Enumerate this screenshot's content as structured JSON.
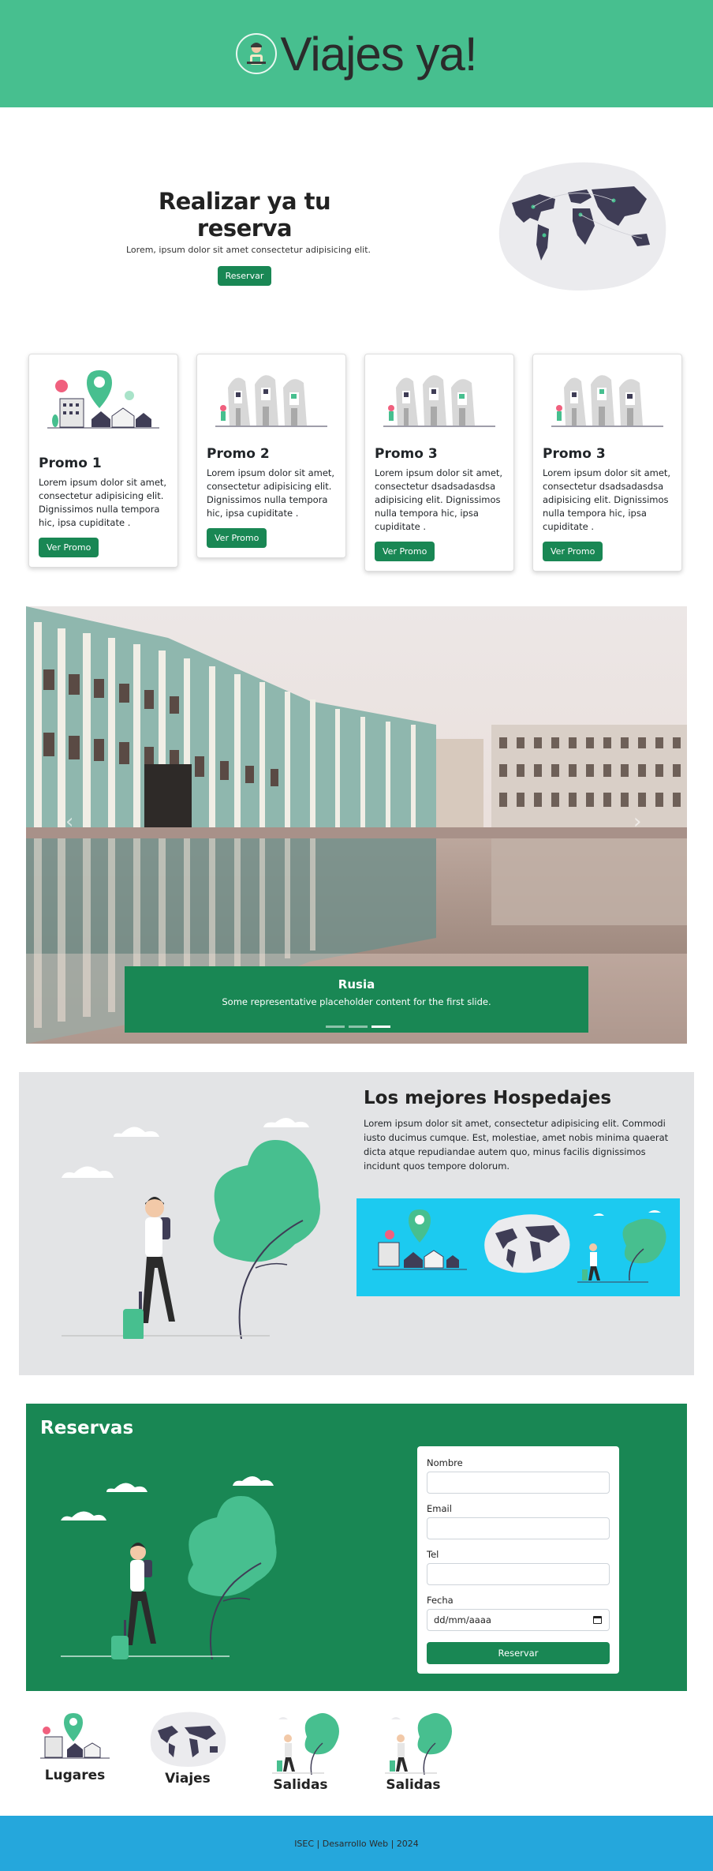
{
  "header": {
    "title": "Viajes ya!",
    "logo_icon": "traveler-avatar-icon"
  },
  "hero": {
    "title": "Realizar ya tu reserva",
    "subtitle": "Lorem, ipsum dolor sit amet consectetur adipisicing elit.",
    "button": "Reservar",
    "image_icon": "world-map-illustration"
  },
  "cards": [
    {
      "title": "Promo 1",
      "text": "Lorem ipsum dolor sit amet, consectetur adipisicing elit. Dignissimos nulla tempora hic, ipsa cupiditate .",
      "button": "Ver Promo"
    },
    {
      "title": "Promo 2",
      "text": "Lorem ipsum dolor sit amet, consectetur adipisicing elit. Dignissimos nulla tempora hic, ipsa cupiditate .",
      "button": "Ver Promo"
    },
    {
      "title": "Promo 3",
      "text": "Lorem ipsum dolor sit amet, consectetur dsadsadasdsa adipisicing elit. Dignissimos nulla tempora hic, ipsa cupiditate .",
      "button": "Ver Promo"
    },
    {
      "title": "Promo 3",
      "text": "Lorem ipsum dolor sit amet, consectetur dsadsadasdsa adipisicing elit. Dignissimos nulla tempora hic, ipsa cupiditate .",
      "button": "Ver Promo"
    }
  ],
  "carousel": {
    "caption_title": "Rusia",
    "caption_text": "Some representative placeholder content for the first slide.",
    "slide_count": 3,
    "active_slide": 3,
    "prev_icon": "chevron-left-icon",
    "next_icon": "chevron-right-icon"
  },
  "hospedajes": {
    "title": "Los mejores Hospedajes",
    "text": "Lorem ipsum dolor sit amet, consectetur adipisicing elit. Commodi iusto ducimus cumque. Est, molestiae, amet nobis minima quaerat dicta atque repudiandae autem quo, minus facilis dignissimos incidunt quos tempore dolorum."
  },
  "reservas": {
    "title": "Reservas",
    "form": {
      "nombre_label": "Nombre",
      "email_label": "Email",
      "tel_label": "Tel",
      "fecha_label": "Fecha",
      "fecha_placeholder": "dd/mm/aaaa",
      "submit": "Reservar"
    }
  },
  "icons": [
    {
      "label": "Lugares",
      "icon": "location-pin-city-icon"
    },
    {
      "label": "Viajes",
      "icon": "world-map-icon"
    },
    {
      "label": "Salidas",
      "icon": "traveler-tree-icon"
    },
    {
      "label": "Salidas",
      "icon": "traveler-tree-icon"
    }
  ],
  "footer": {
    "text": "ISEC | Desarrollo Web | 2024"
  },
  "colors": {
    "header": "#47bf8f",
    "primary": "#198754",
    "footer": "#25a7dc",
    "banner": "#1ccaf0",
    "section_gray": "#e3e4e6"
  }
}
